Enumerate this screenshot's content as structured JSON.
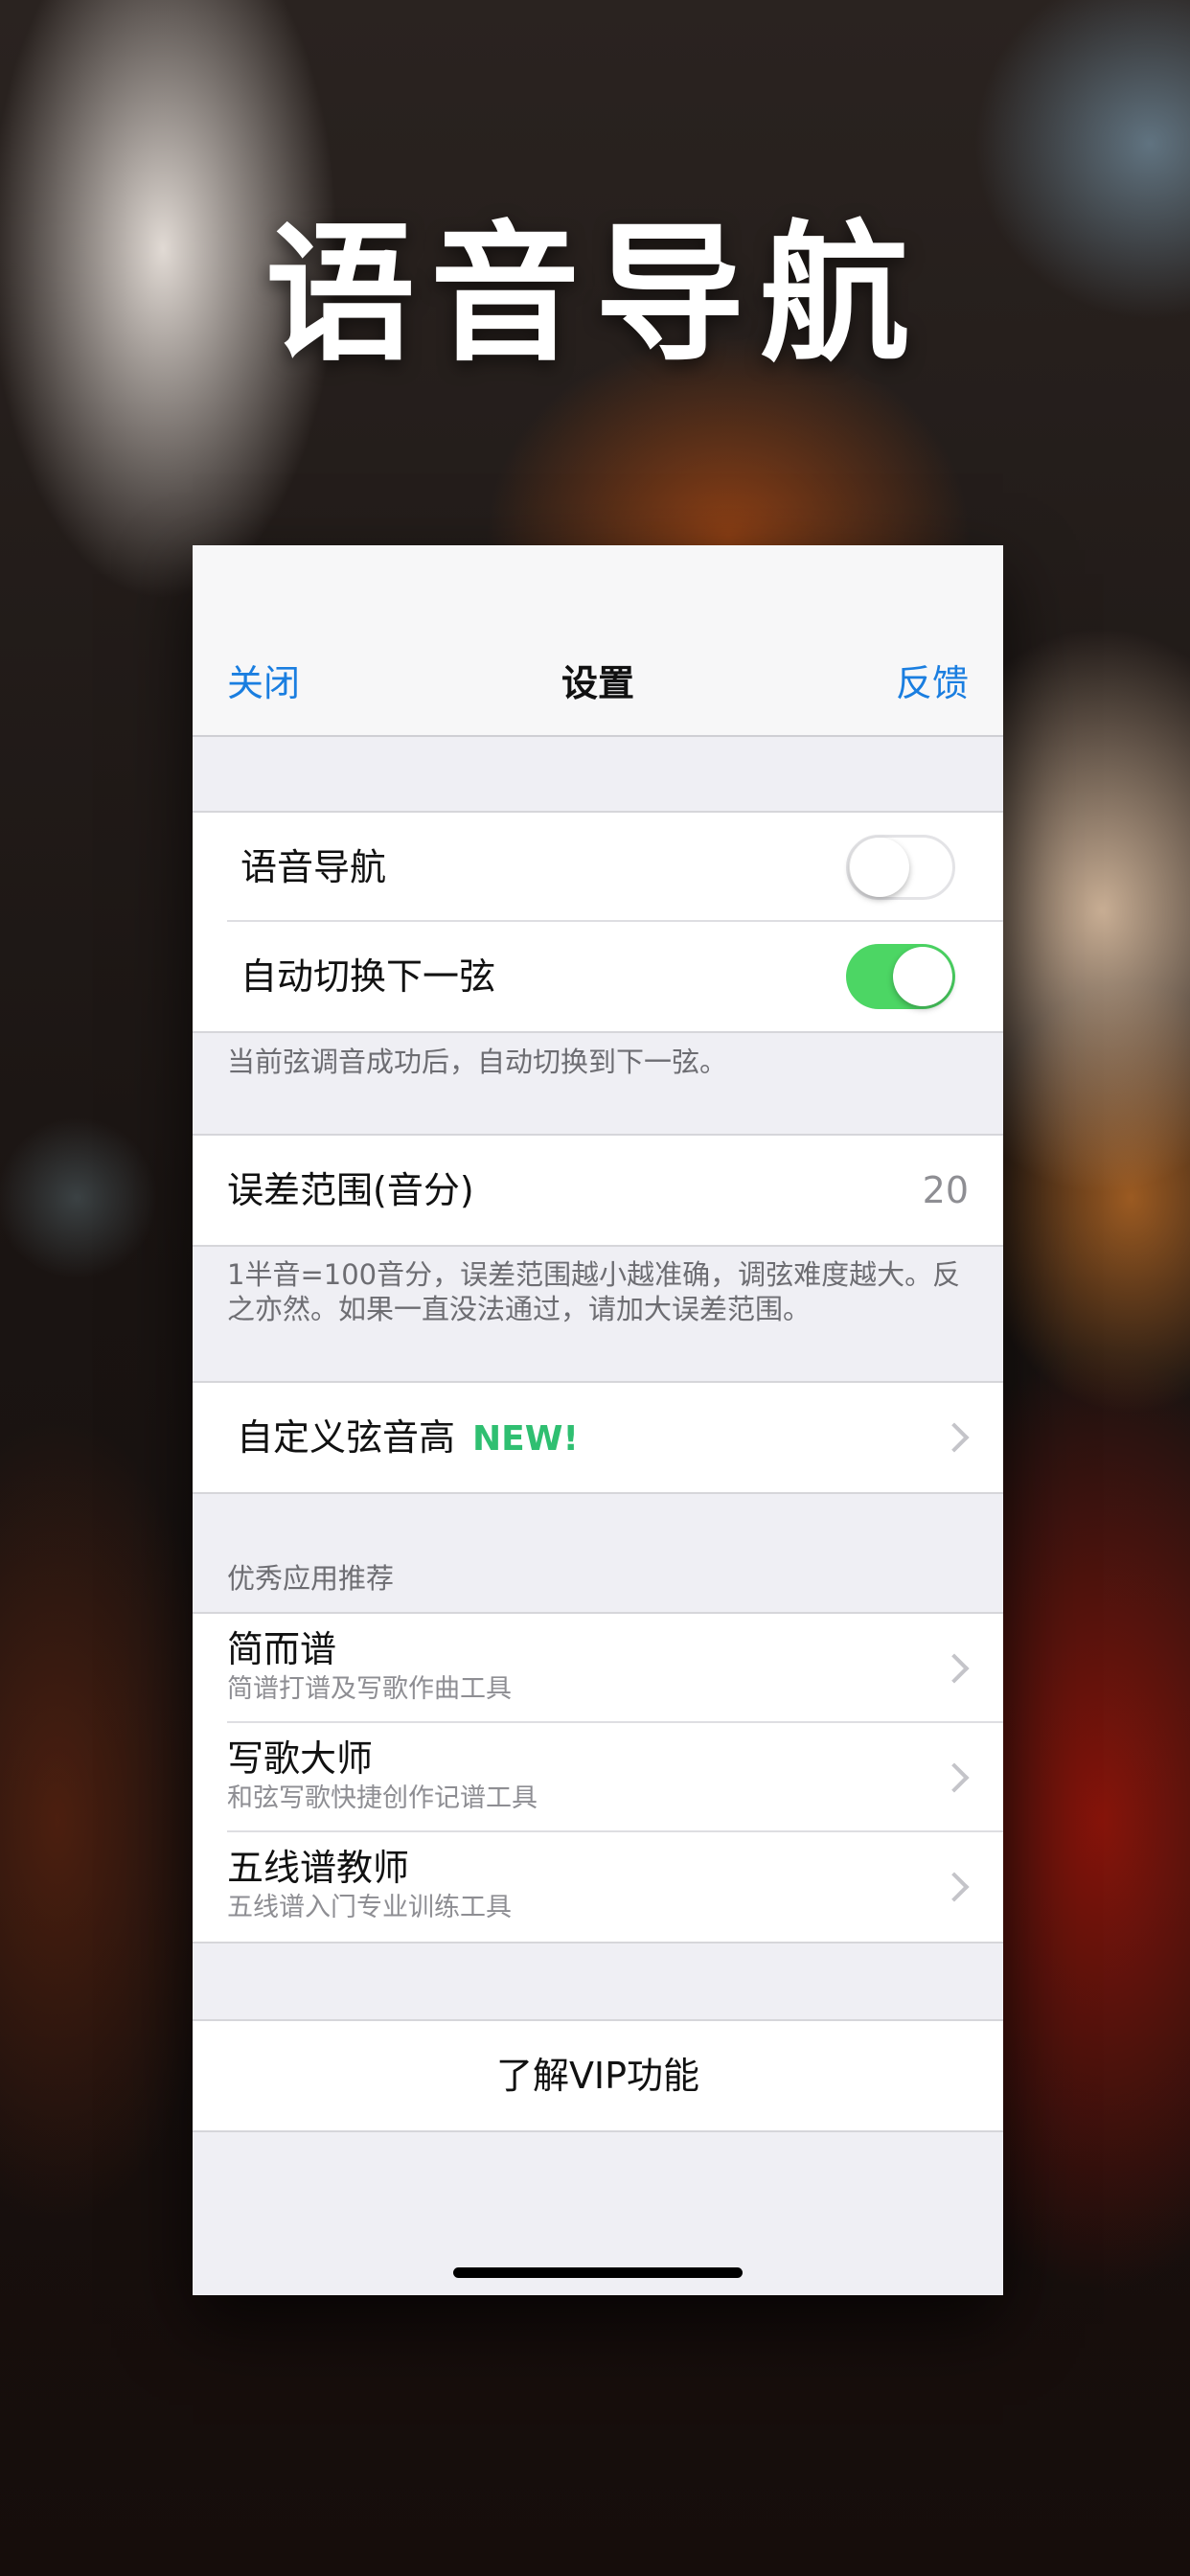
{
  "hero": {
    "title": "语音导航"
  },
  "navbar": {
    "close": "关闭",
    "title": "设置",
    "feedback": "反馈"
  },
  "voice_nav": {
    "label": "语音导航",
    "enabled": false
  },
  "auto_switch": {
    "label": "自动切换下一弦",
    "enabled": true,
    "note": "当前弦调音成功后，自动切换到下一弦。"
  },
  "tolerance": {
    "label": "误差范围(音分)",
    "value": "20",
    "note": "1半音=100音分，误差范围越小越准确，调弦难度越大。反之亦然。如果一直没法通过，请加大误差范围。"
  },
  "custom_pitch": {
    "label": "自定义弦音高",
    "badge": "NEW!"
  },
  "recommend": {
    "header": "优秀应用推荐",
    "apps": [
      {
        "title": "简而谱",
        "subtitle": "简谱打谱及写歌作曲工具"
      },
      {
        "title": "写歌大师",
        "subtitle": "和弦写歌快捷创作记谱工具"
      },
      {
        "title": "五线谱教师",
        "subtitle": "五线谱入门专业训练工具"
      }
    ]
  },
  "vip": {
    "label": "了解VIP功能"
  },
  "colors": {
    "accent": "#1a7ee0",
    "toggle_on": "#4cd664",
    "new_badge": "#2fbf71"
  }
}
